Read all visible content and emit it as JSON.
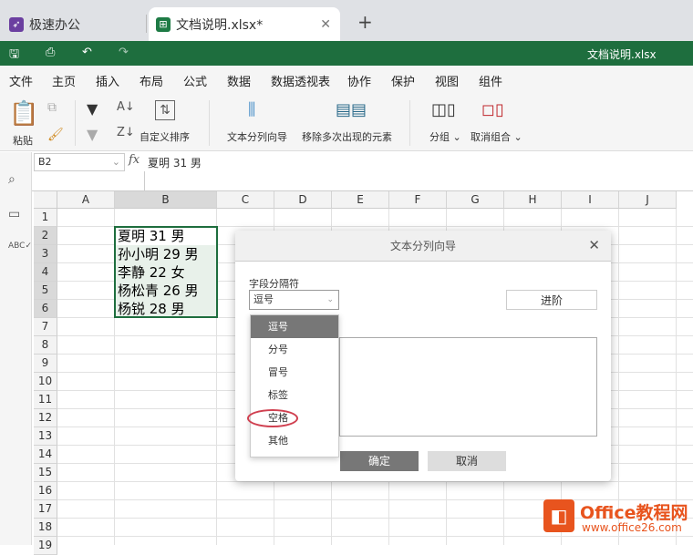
{
  "tabs": [
    {
      "label": "极速办公"
    },
    {
      "label": "文档说明.xlsx*"
    }
  ],
  "titlebar": {
    "filename": "文档说明.xlsx"
  },
  "menu": [
    "文件",
    "主页",
    "插入",
    "布局",
    "公式",
    "数据",
    "数据透视表",
    "协作",
    "保护",
    "视图",
    "组件"
  ],
  "ribbon": {
    "paste": "粘贴",
    "custom_sort": "自定义排序",
    "text_to_columns": "文本分列向导",
    "remove_duplicates": "移除多次出现的元素",
    "group": "分组",
    "ungroup": "取消组合"
  },
  "formula": {
    "cell_ref": "B2",
    "fx": "fx",
    "value": "夏明 31 男"
  },
  "columns": [
    "A",
    "B",
    "C",
    "D",
    "E",
    "F",
    "G",
    "H",
    "I",
    "J"
  ],
  "rows": [
    "1",
    "2",
    "3",
    "4",
    "5",
    "6",
    "7",
    "8",
    "9",
    "10",
    "11",
    "12",
    "13",
    "14",
    "15",
    "16",
    "17",
    "18",
    "19"
  ],
  "cells": [
    "夏明 31 男",
    "孙小明 29 男",
    "李静 22 女",
    "杨松青 26 男",
    "杨锐 28 男"
  ],
  "dialog": {
    "title": "文本分列向导",
    "field_label": "字段分隔符",
    "selected": "逗号",
    "advanced": "进阶",
    "ok": "确定",
    "cancel": "取消",
    "options": [
      "逗号",
      "分号",
      "冒号",
      "标签",
      "空格",
      "其他"
    ]
  },
  "watermark": {
    "title": "Office教程网",
    "url": "www.office26.com"
  }
}
